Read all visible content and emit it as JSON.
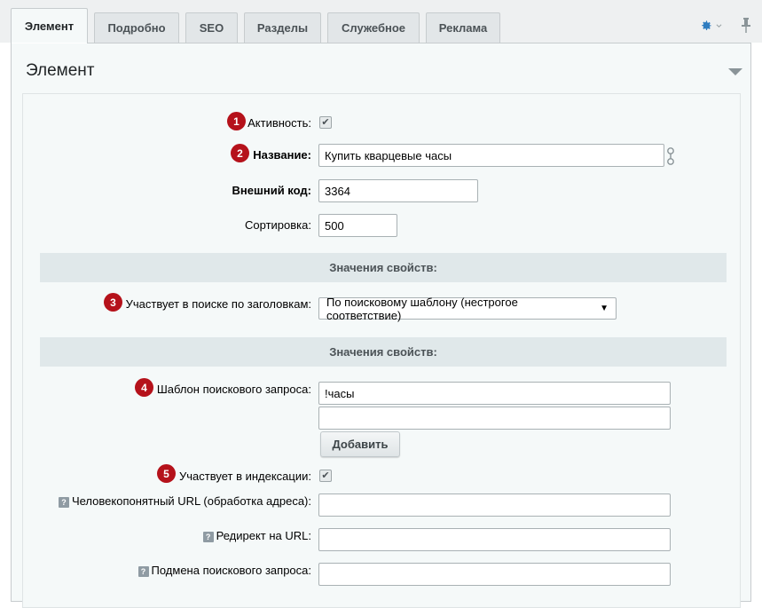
{
  "tabs": [
    {
      "label": "Элемент",
      "active": true
    },
    {
      "label": "Подробно",
      "active": false
    },
    {
      "label": "SEO",
      "active": false
    },
    {
      "label": "Разделы",
      "active": false
    },
    {
      "label": "Служебное",
      "active": false
    },
    {
      "label": "Реклама",
      "active": false
    }
  ],
  "section": {
    "title": "Элемент"
  },
  "form": {
    "active": {
      "badge": "1",
      "label": "Активность:",
      "checked": true
    },
    "name": {
      "badge": "2",
      "label": "Название:",
      "value": "Купить кварцевые часы"
    },
    "external_code": {
      "label": "Внешний код:",
      "value": "3364"
    },
    "sort": {
      "label": "Сортировка:",
      "value": "500"
    },
    "group1": {
      "title": "Значения свойств:"
    },
    "search_title": {
      "badge": "3",
      "label": "Участвует в поиске по заголовкам:",
      "selected": "По поисковому шаблону (нестрогое соответствие)"
    },
    "group2": {
      "title": "Значения свойств:"
    },
    "search_template": {
      "badge": "4",
      "label": "Шаблон поискового запроса:",
      "values": [
        "!часы",
        ""
      ],
      "add_button": "Добавить"
    },
    "indexing": {
      "badge": "5",
      "label": "Участвует в индексации:",
      "checked": true
    },
    "human_url": {
      "label": "Человекопонятный URL (обработка адреса):",
      "value": ""
    },
    "redirect": {
      "label": "Редирект на URL:",
      "value": ""
    },
    "query_replace": {
      "label": "Подмена поискового запроса:",
      "value": ""
    }
  },
  "help_glyph": "?",
  "check_glyph": "✔",
  "caret_glyph": "▼",
  "icons": [
    "gear-icon",
    "pin-icon",
    "collapse-arrow-icon",
    "help-icon",
    "link-icon",
    "checkbox-icon"
  ],
  "colors": {
    "badge": "#b5121b",
    "gear": "#2f7dc0",
    "panel": "#f5f9f9",
    "group_header": "#e0e8ea"
  }
}
